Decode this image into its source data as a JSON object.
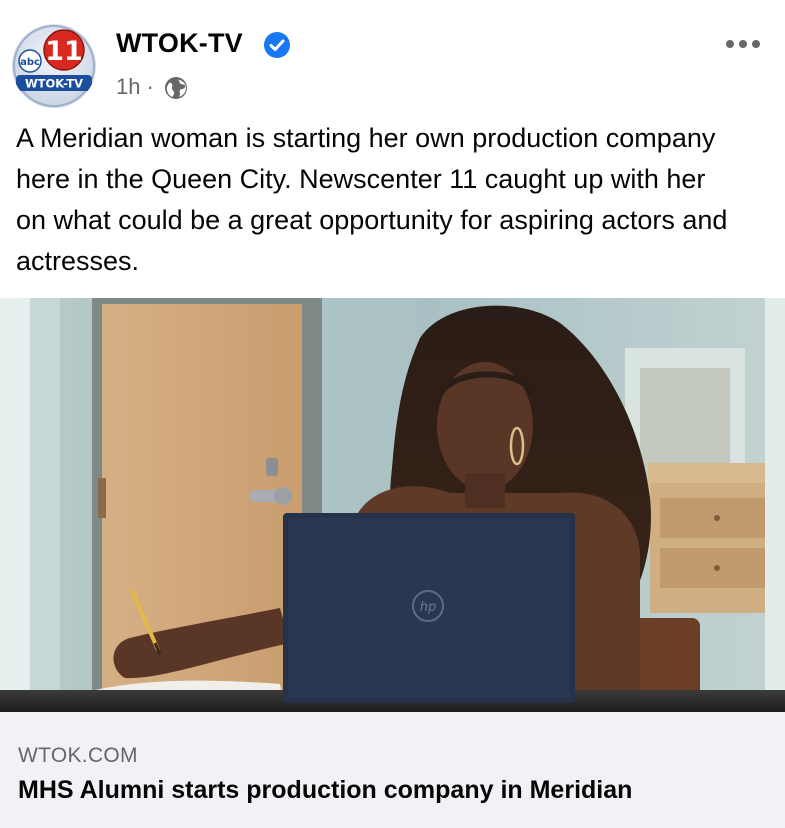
{
  "post": {
    "author": "WTOK-TV",
    "verified": true,
    "time": "1h",
    "separator": "·",
    "audience_icon": "globe-icon",
    "more_icon": "more-options-icon",
    "text": "A Meridian woman is starting her own production company here in the Queen City. Newscenter 11 caught up with her on what could be a great opportunity for aspiring actors and actresses."
  },
  "logo": {
    "abc": "abc",
    "number": "11",
    "station": "WTOK-TV"
  },
  "link_preview": {
    "domain": "WTOK.COM",
    "title": "MHS Alumni starts production company in Meridian"
  },
  "photo": {
    "laptop_brand": "hp"
  },
  "colors": {
    "verified_blue": "#1877f2",
    "secondary_text": "#65676b",
    "preview_bg": "#f0f2f5",
    "logo_red": "#d9281f",
    "logo_blue": "#1b4f9c"
  }
}
